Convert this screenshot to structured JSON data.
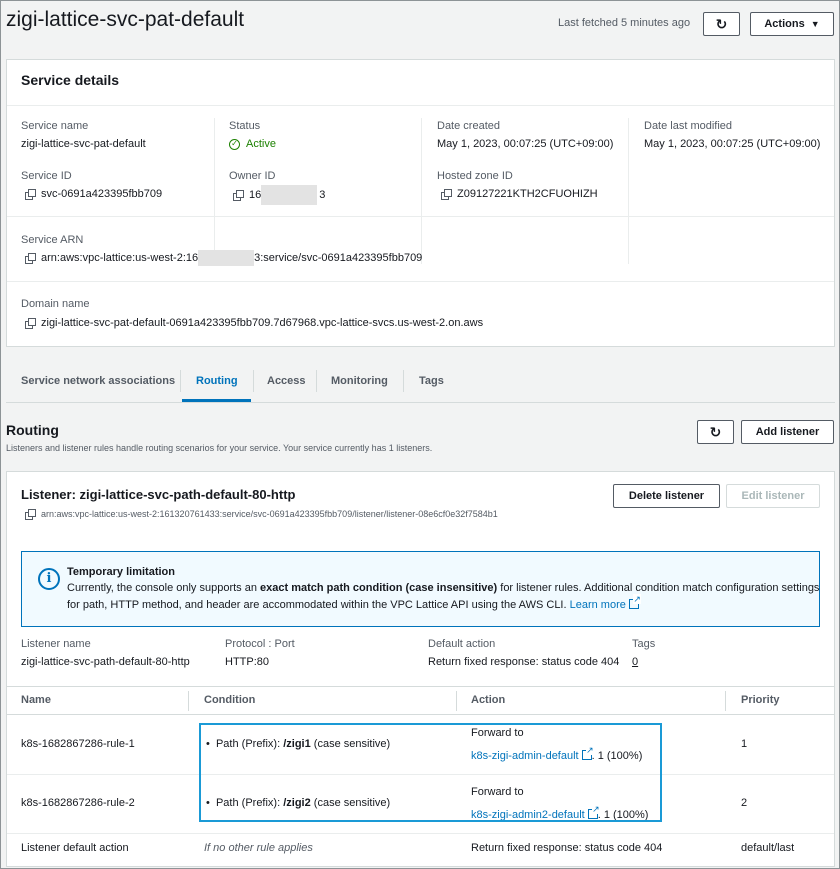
{
  "header": {
    "title": "zigi-lattice-svc-pat-default",
    "last_fetched": "Last fetched 5 minutes ago",
    "actions_label": "Actions"
  },
  "service_details": {
    "heading": "Service details",
    "service_name_label": "Service name",
    "service_name": "zigi-lattice-svc-pat-default",
    "status_label": "Status",
    "status": "Active",
    "date_created_label": "Date created",
    "date_created": "May 1, 2023, 00:07:25 (UTC+09:00)",
    "date_modified_label": "Date last modified",
    "date_modified": "May 1, 2023, 00:07:25 (UTC+09:00)",
    "service_id_label": "Service ID",
    "service_id": "svc-0691a423395fbb709",
    "owner_id_label": "Owner ID",
    "owner_id_prefix": "16",
    "owner_id_suffix": "3",
    "hosted_zone_label": "Hosted zone ID",
    "hosted_zone": "Z09127221KTH2CFUOHIZH",
    "arn_label": "Service ARN",
    "arn_prefix": "arn:aws:vpc-lattice:us-west-2:16",
    "arn_suffix": "3:service/svc-0691a423395fbb709",
    "domain_label": "Domain name",
    "domain": "zigi-lattice-svc-pat-default-0691a423395fbb709.7d67968.vpc-lattice-svcs.us-west-2.on.aws"
  },
  "tabs": [
    "Service network associations",
    "Routing",
    "Access",
    "Monitoring",
    "Tags"
  ],
  "routing": {
    "heading": "Routing",
    "description": "Listeners and listener rules handle routing scenarios for your service. Your service currently has 1 listeners.",
    "add_listener": "Add listener"
  },
  "listener": {
    "heading": "Listener: zigi-lattice-svc-path-default-80-http",
    "arn": "arn:aws:vpc-lattice:us-west-2:161320761433:service/svc-0691a423395fbb709/listener/listener-08e6cf0e32f7584b1",
    "delete": "Delete listener",
    "edit": "Edit listener",
    "info_title": "Temporary limitation",
    "info_line1_a": "Currently, the console only supports an ",
    "info_line1_b": "exact match path condition (case insensitive)",
    "info_line1_c": " for listener rules. Additional condition match configuration settings",
    "info_line2": "for path, HTTP method, and header are accommodated within the VPC Lattice API using the AWS CLI. ",
    "info_link": "Learn more",
    "name_label": "Listener name",
    "name": "zigi-lattice-svc-path-default-80-http",
    "protocol_label": "Protocol : Port",
    "protocol": "HTTP:80",
    "default_action_label": "Default action",
    "default_action": "Return fixed response: status code 404",
    "tags_label": "Tags",
    "tags_count": "0"
  },
  "rules_table": {
    "headers": [
      "Name",
      "Condition",
      "Action",
      "Priority"
    ],
    "rows": [
      {
        "name": "k8s-1682867286-rule-1",
        "cond_prefix": "Path (Prefix): ",
        "cond_path": "/zigi1",
        "cond_suffix": " (case sensitive)",
        "action_label": "Forward to",
        "target": "k8s-zigi-admin-default",
        "weight": ": 1 (100%)",
        "priority": "1"
      },
      {
        "name": "k8s-1682867286-rule-2",
        "cond_prefix": "Path (Prefix): ",
        "cond_path": "/zigi2",
        "cond_suffix": " (case sensitive)",
        "action_label": "Forward to",
        "target": "k8s-zigi-admin2-default",
        "weight": ": 1 (100%)",
        "priority": "2"
      }
    ],
    "default_row": {
      "name": "Listener default action",
      "condition": "If no other rule applies",
      "action": "Return fixed response: status code 404",
      "priority": "default/last"
    }
  },
  "colors": {
    "link": "#0073bb",
    "active": "#1d8102",
    "highlight": "#1a9ad6"
  }
}
